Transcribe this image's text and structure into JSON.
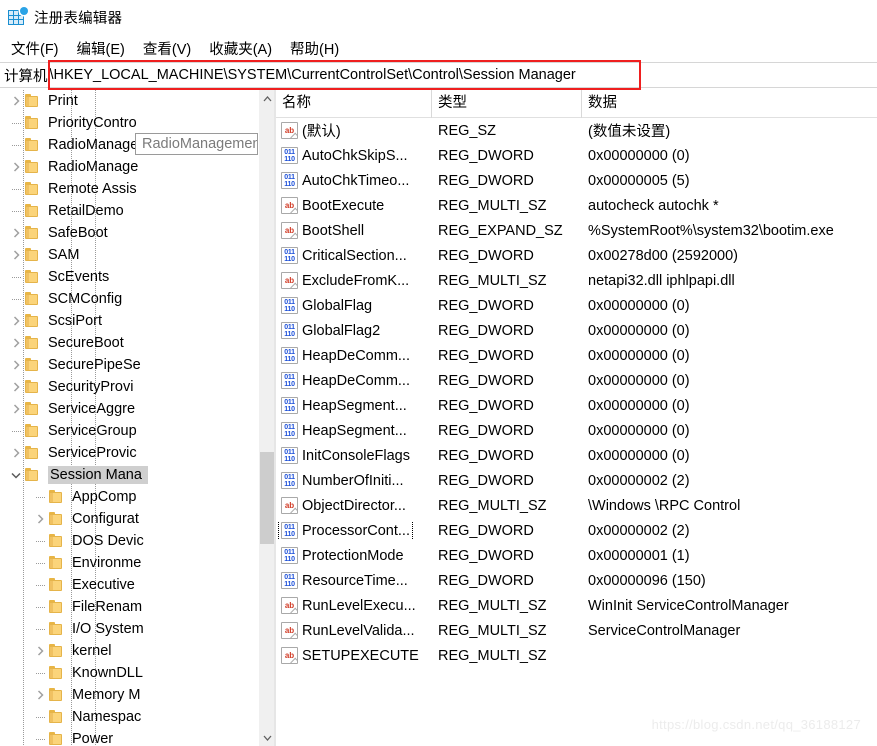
{
  "window": {
    "title": "注册表编辑器",
    "icon": "registry-editor-icon"
  },
  "menubar": {
    "items": [
      {
        "label": "文件(F)",
        "name": "menu-file"
      },
      {
        "label": "编辑(E)",
        "name": "menu-edit"
      },
      {
        "label": "查看(V)",
        "name": "menu-view"
      },
      {
        "label": "收藏夹(A)",
        "name": "menu-favorites"
      },
      {
        "label": "帮助(H)",
        "name": "menu-help"
      }
    ]
  },
  "address_bar": {
    "computer_label": "计算机",
    "path": "\\HKEY_LOCAL_MACHINE\\SYSTEM\\CurrentControlSet\\Control\\Session Manager",
    "highlight_color": "#ef1f1f"
  },
  "tree": {
    "tooltip": "RadioManagement",
    "selected_key": "Session Manager",
    "items": [
      {
        "label": "Print",
        "indent": 1,
        "expandable": true,
        "expanded": false
      },
      {
        "label": "PriorityContro",
        "indent": 1,
        "expandable": false,
        "expanded": false
      },
      {
        "label": "RadioManagement",
        "indent": 1,
        "expandable": false,
        "expanded": false
      },
      {
        "label": "RadioManage",
        "indent": 1,
        "expandable": true,
        "expanded": false
      },
      {
        "label": "Remote Assis",
        "indent": 1,
        "expandable": false,
        "expanded": false
      },
      {
        "label": "RetailDemo",
        "indent": 1,
        "expandable": false,
        "expanded": false
      },
      {
        "label": "SafeBoot",
        "indent": 1,
        "expandable": true,
        "expanded": false
      },
      {
        "label": "SAM",
        "indent": 1,
        "expandable": true,
        "expanded": false
      },
      {
        "label": "ScEvents",
        "indent": 1,
        "expandable": false,
        "expanded": false
      },
      {
        "label": "SCMConfig",
        "indent": 1,
        "expandable": false,
        "expanded": false
      },
      {
        "label": "ScsiPort",
        "indent": 1,
        "expandable": true,
        "expanded": false
      },
      {
        "label": "SecureBoot",
        "indent": 1,
        "expandable": true,
        "expanded": false
      },
      {
        "label": "SecurePipeSe",
        "indent": 1,
        "expandable": true,
        "expanded": false
      },
      {
        "label": "SecurityProvi",
        "indent": 1,
        "expandable": true,
        "expanded": false
      },
      {
        "label": "ServiceAggre",
        "indent": 1,
        "expandable": true,
        "expanded": false
      },
      {
        "label": "ServiceGroup",
        "indent": 1,
        "expandable": false,
        "expanded": false
      },
      {
        "label": "ServiceProvic",
        "indent": 1,
        "expandable": true,
        "expanded": false
      },
      {
        "label": "Session Mana",
        "indent": 1,
        "expandable": true,
        "expanded": true,
        "selected": true
      },
      {
        "label": "AppComp",
        "indent": 2,
        "expandable": false,
        "expanded": false
      },
      {
        "label": "Configurat",
        "indent": 2,
        "expandable": true,
        "expanded": false
      },
      {
        "label": "DOS Devic",
        "indent": 2,
        "expandable": false,
        "expanded": false
      },
      {
        "label": "Environme",
        "indent": 2,
        "expandable": false,
        "expanded": false
      },
      {
        "label": "Executive",
        "indent": 2,
        "expandable": false,
        "expanded": false
      },
      {
        "label": "FileRenam",
        "indent": 2,
        "expandable": false,
        "expanded": false
      },
      {
        "label": "I/O System",
        "indent": 2,
        "expandable": false,
        "expanded": false
      },
      {
        "label": "kernel",
        "indent": 2,
        "expandable": true,
        "expanded": false
      },
      {
        "label": "KnownDLL",
        "indent": 2,
        "expandable": false,
        "expanded": false
      },
      {
        "label": "Memory M",
        "indent": 2,
        "expandable": true,
        "expanded": false
      },
      {
        "label": "Namespac",
        "indent": 2,
        "expandable": false,
        "expanded": false
      },
      {
        "label": "Power",
        "indent": 2,
        "expandable": false,
        "expanded": false
      }
    ]
  },
  "list": {
    "columns": [
      "名称",
      "类型",
      "数据"
    ],
    "focused_row": "ProcessorCont...",
    "rows": [
      {
        "name": "(默认)",
        "icon": "string-value-icon",
        "type": "REG_SZ",
        "data": "(数值未设置)"
      },
      {
        "name": "AutoChkSkipS...",
        "icon": "binary-value-icon",
        "type": "REG_DWORD",
        "data": "0x00000000 (0)"
      },
      {
        "name": "AutoChkTimeo...",
        "icon": "binary-value-icon",
        "type": "REG_DWORD",
        "data": "0x00000005 (5)"
      },
      {
        "name": "BootExecute",
        "icon": "string-value-icon",
        "type": "REG_MULTI_SZ",
        "data": "autocheck autochk *"
      },
      {
        "name": "BootShell",
        "icon": "string-value-icon",
        "type": "REG_EXPAND_SZ",
        "data": "%SystemRoot%\\system32\\bootim.exe"
      },
      {
        "name": "CriticalSection...",
        "icon": "binary-value-icon",
        "type": "REG_DWORD",
        "data": "0x00278d00 (2592000)"
      },
      {
        "name": "ExcludeFromK...",
        "icon": "string-value-icon",
        "type": "REG_MULTI_SZ",
        "data": "netapi32.dll iphlpapi.dll"
      },
      {
        "name": "GlobalFlag",
        "icon": "binary-value-icon",
        "type": "REG_DWORD",
        "data": "0x00000000 (0)"
      },
      {
        "name": "GlobalFlag2",
        "icon": "binary-value-icon",
        "type": "REG_DWORD",
        "data": "0x00000000 (0)"
      },
      {
        "name": "HeapDeComm...",
        "icon": "binary-value-icon",
        "type": "REG_DWORD",
        "data": "0x00000000 (0)"
      },
      {
        "name": "HeapDeComm...",
        "icon": "binary-value-icon",
        "type": "REG_DWORD",
        "data": "0x00000000 (0)"
      },
      {
        "name": "HeapSegment...",
        "icon": "binary-value-icon",
        "type": "REG_DWORD",
        "data": "0x00000000 (0)"
      },
      {
        "name": "HeapSegment...",
        "icon": "binary-value-icon",
        "type": "REG_DWORD",
        "data": "0x00000000 (0)"
      },
      {
        "name": "InitConsoleFlags",
        "icon": "binary-value-icon",
        "type": "REG_DWORD",
        "data": "0x00000000 (0)"
      },
      {
        "name": "NumberOfIniti...",
        "icon": "binary-value-icon",
        "type": "REG_DWORD",
        "data": "0x00000002 (2)"
      },
      {
        "name": "ObjectDirector...",
        "icon": "string-value-icon",
        "type": "REG_MULTI_SZ",
        "data": "\\Windows \\RPC Control"
      },
      {
        "name": "ProcessorCont...",
        "icon": "binary-value-icon",
        "type": "REG_DWORD",
        "data": "0x00000002 (2)",
        "focused": true
      },
      {
        "name": "ProtectionMode",
        "icon": "binary-value-icon",
        "type": "REG_DWORD",
        "data": "0x00000001 (1)"
      },
      {
        "name": "ResourceTime...",
        "icon": "binary-value-icon",
        "type": "REG_DWORD",
        "data": "0x00000096 (150)"
      },
      {
        "name": "RunLevelExecu...",
        "icon": "string-value-icon",
        "type": "REG_MULTI_SZ",
        "data": "WinInit ServiceControlManager"
      },
      {
        "name": "RunLevelValida...",
        "icon": "string-value-icon",
        "type": "REG_MULTI_SZ",
        "data": "ServiceControlManager"
      },
      {
        "name": "SETUPEXECUTE",
        "icon": "string-value-icon",
        "type": "REG_MULTI_SZ",
        "data": ""
      }
    ]
  },
  "watermark": {
    "text": "https://blog.csdn.net/qq_36188127"
  }
}
